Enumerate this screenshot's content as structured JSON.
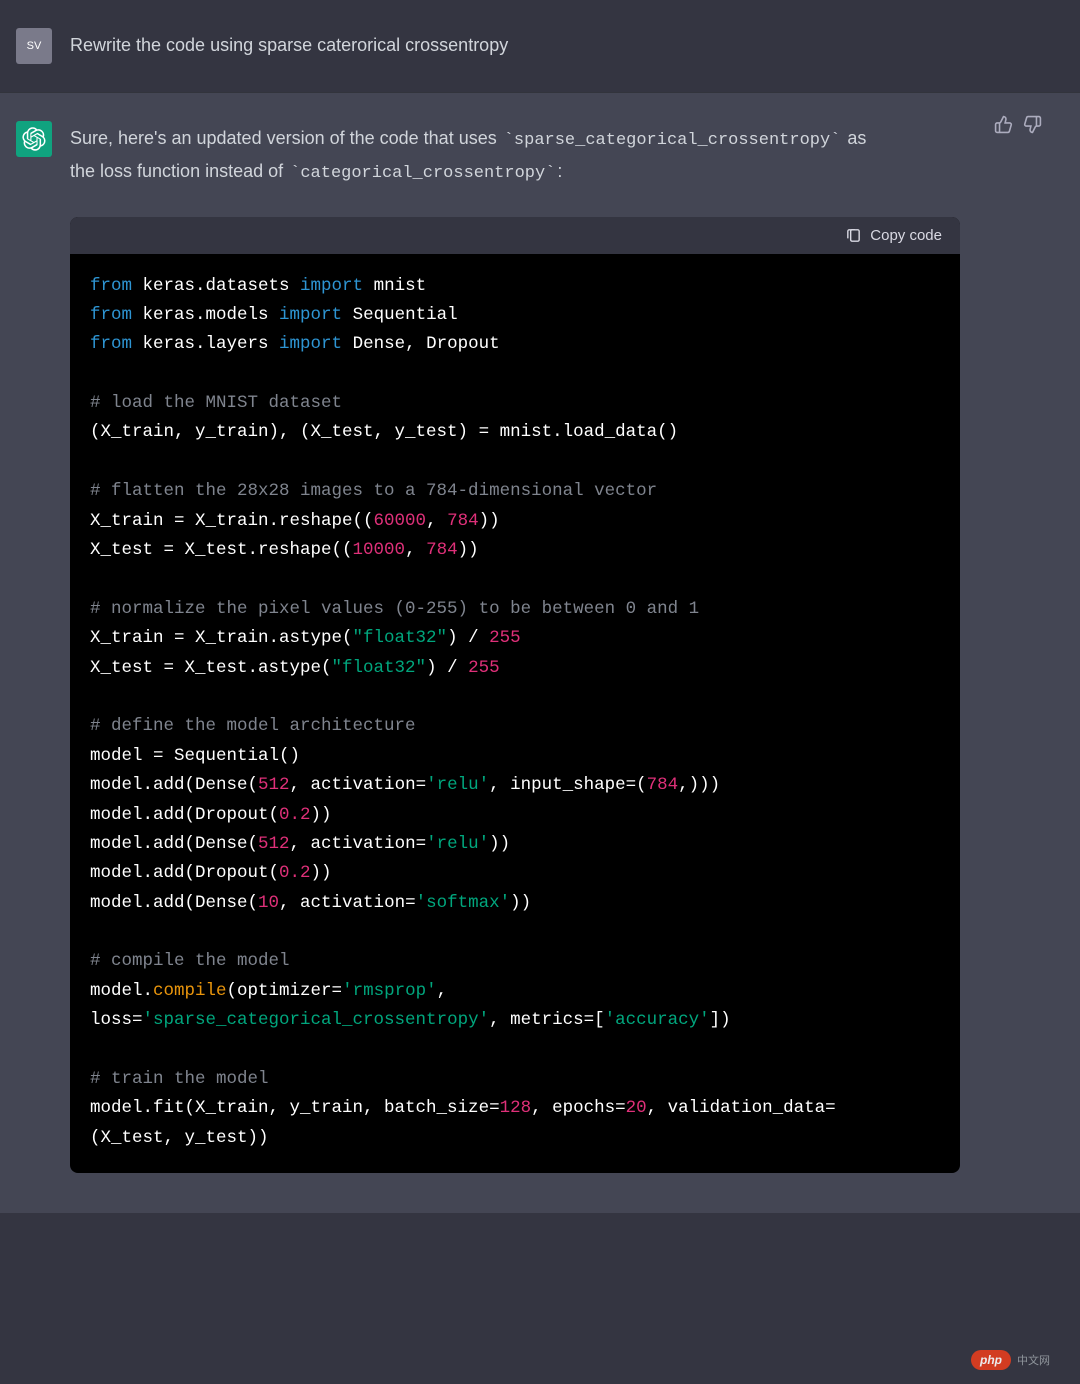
{
  "user": {
    "avatar_initials": "SV",
    "message": "Rewrite the code using sparse caterorical crossentropy"
  },
  "assistant": {
    "intro_text_before": "Sure, here's an updated version of the code that uses ",
    "intro_code1": "sparse_categorical_crossentropy",
    "intro_text_mid": " as the loss function instead of ",
    "intro_code2": "categorical_crossentropy",
    "intro_text_after": ":",
    "copy_label": "Copy code",
    "code": {
      "l1_from": "from",
      "l1_mod": " keras.datasets ",
      "l1_import": "import",
      "l1_name": " mnist",
      "l2_from": "from",
      "l2_mod": " keras.models ",
      "l2_import": "import",
      "l2_name": " Sequential",
      "l3_from": "from",
      "l3_mod": " keras.layers ",
      "l3_import": "import",
      "l3_name": " Dense, Dropout",
      "c1": "# load the MNIST dataset",
      "l4": "(X_train, y_train), (X_test, y_test) = mnist.load_data()",
      "c2": "# flatten the 28x28 images to a 784-dimensional vector",
      "l5_a": "X_train = X_train.reshape((",
      "l5_n1": "60000",
      "l5_b": ", ",
      "l5_n2": "784",
      "l5_c": "))",
      "l6_a": "X_test = X_test.reshape((",
      "l6_n1": "10000",
      "l6_b": ", ",
      "l6_n2": "784",
      "l6_c": "))",
      "c3": "# normalize the pixel values (0-255) to be between 0 and 1",
      "l7_a": "X_train = X_train.astype(",
      "l7_s": "\"float32\"",
      "l7_b": ") / ",
      "l7_n": "255",
      "l8_a": "X_test = X_test.astype(",
      "l8_s": "\"float32\"",
      "l8_b": ") / ",
      "l8_n": "255",
      "c4": "# define the model architecture",
      "l9": "model = Sequential()",
      "l10_a": "model.add(Dense(",
      "l10_n1": "512",
      "l10_b": ", activation=",
      "l10_s1": "'relu'",
      "l10_c": ", input_shape=(",
      "l10_n2": "784",
      "l10_d": ",)))",
      "l11_a": "model.add(Dropout(",
      "l11_n": "0.2",
      "l11_b": "))",
      "l12_a": "model.add(Dense(",
      "l12_n": "512",
      "l12_b": ", activation=",
      "l12_s": "'relu'",
      "l12_c": "))",
      "l13_a": "model.add(Dropout(",
      "l13_n": "0.2",
      "l13_b": "))",
      "l14_a": "model.add(Dense(",
      "l14_n": "10",
      "l14_b": ", activation=",
      "l14_s": "'softmax'",
      "l14_c": "))",
      "c5": "# compile the model",
      "l15_a": "model.",
      "l15_fn": "compile",
      "l15_b": "(optimizer=",
      "l15_s": "'rmsprop'",
      "l15_c": ",",
      "l16_a": "loss=",
      "l16_s1": "'sparse_categorical_crossentropy'",
      "l16_b": ", metrics=[",
      "l16_s2": "'accuracy'",
      "l16_c": "])",
      "c6": "# train the model",
      "l17_a": "model.fit(X_train, y_train, batch_size=",
      "l17_n1": "128",
      "l17_b": ", epochs=",
      "l17_n2": "20",
      "l17_c": ", validation_data=",
      "l18": "(X_test, y_test))"
    }
  },
  "watermark": {
    "pill": "php",
    "text": "中文网"
  }
}
